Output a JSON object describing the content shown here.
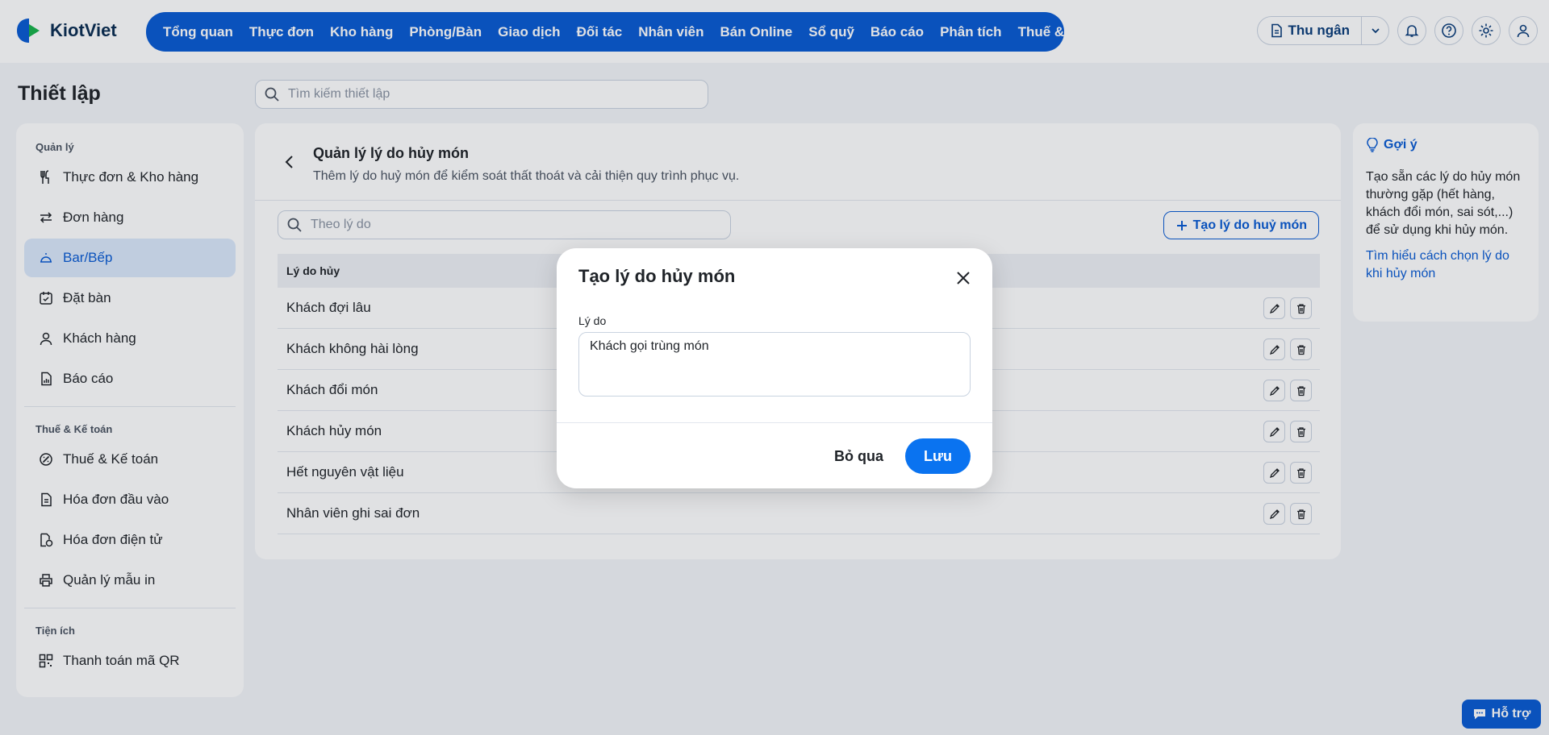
{
  "app": {
    "logo_text": "KiotViet"
  },
  "nav": {
    "items": [
      "Tổng quan",
      "Thực đơn",
      "Kho hàng",
      "Phòng/Bàn",
      "Giao dịch",
      "Đối tác",
      "Nhân viên",
      "Bán Online",
      "Sổ quỹ",
      "Báo cáo",
      "Phân tích",
      "Thuế & Kế toán"
    ]
  },
  "header": {
    "cashier_label": "Thu ngân",
    "icons": [
      "bell-icon",
      "help-icon",
      "gear-icon",
      "user-icon"
    ]
  },
  "page": {
    "title": "Thiết lập",
    "search_placeholder": "Tìm kiếm thiết lập"
  },
  "sidebar": {
    "groups": [
      {
        "label": "Quản lý",
        "items": [
          {
            "label": "Thực đơn & Kho hàng",
            "icon": "utensils-icon"
          },
          {
            "label": "Đơn hàng",
            "icon": "swap-icon"
          },
          {
            "label": "Bar/Bếp",
            "icon": "cloche-icon",
            "active": true
          },
          {
            "label": "Đặt bàn",
            "icon": "calendar-check-icon"
          },
          {
            "label": "Khách hàng",
            "icon": "person-icon"
          },
          {
            "label": "Báo cáo",
            "icon": "report-icon"
          }
        ]
      },
      {
        "label": "Thuế & Kế toán",
        "items": [
          {
            "label": "Thuế & Kế toán",
            "icon": "tax-icon"
          },
          {
            "label": "Hóa đơn đầu vào",
            "icon": "document-icon"
          },
          {
            "label": "Hóa đơn điện tử",
            "icon": "e-invoice-icon"
          },
          {
            "label": "Quản lý mẫu in",
            "icon": "printer-icon"
          }
        ]
      },
      {
        "label": "Tiện ích",
        "items": [
          {
            "label": "Thanh toán mã QR",
            "icon": "qr-icon"
          }
        ]
      }
    ]
  },
  "main": {
    "title": "Quản lý lý do hủy món",
    "subtitle": "Thêm lý do huỷ món để kiểm soát thất thoát và cải thiện quy trình phục vụ.",
    "search_placeholder": "Theo lý do",
    "create_label": "Tạo lý do huỷ món",
    "table_header": "Lý do hủy",
    "rows": [
      "Khách đợi lâu",
      "Khách không hài lòng",
      "Khách đổi món",
      "Khách hủy món",
      "Hết nguyên vật liệu",
      "Nhân viên ghi sai đơn"
    ]
  },
  "tips": {
    "title": "Gợi ý",
    "body": "Tạo sẵn các lý do hủy món thường gặp (hết hàng, khách đổi món, sai sót,...) để sử dụng khi hủy món.",
    "link": "Tìm hiểu cách chọn lý do khi hủy món"
  },
  "support": {
    "label": "Hỗ trợ"
  },
  "modal": {
    "title": "Tạo lý do hủy món",
    "field_label": "Lý do",
    "field_value": "Khách gọi trùng món",
    "cancel_label": "Bỏ qua",
    "save_label": "Lưu"
  },
  "colors": {
    "accent": "#0a5bd3",
    "save_button": "#0a73f0",
    "active_bg": "#dbe8fb"
  }
}
